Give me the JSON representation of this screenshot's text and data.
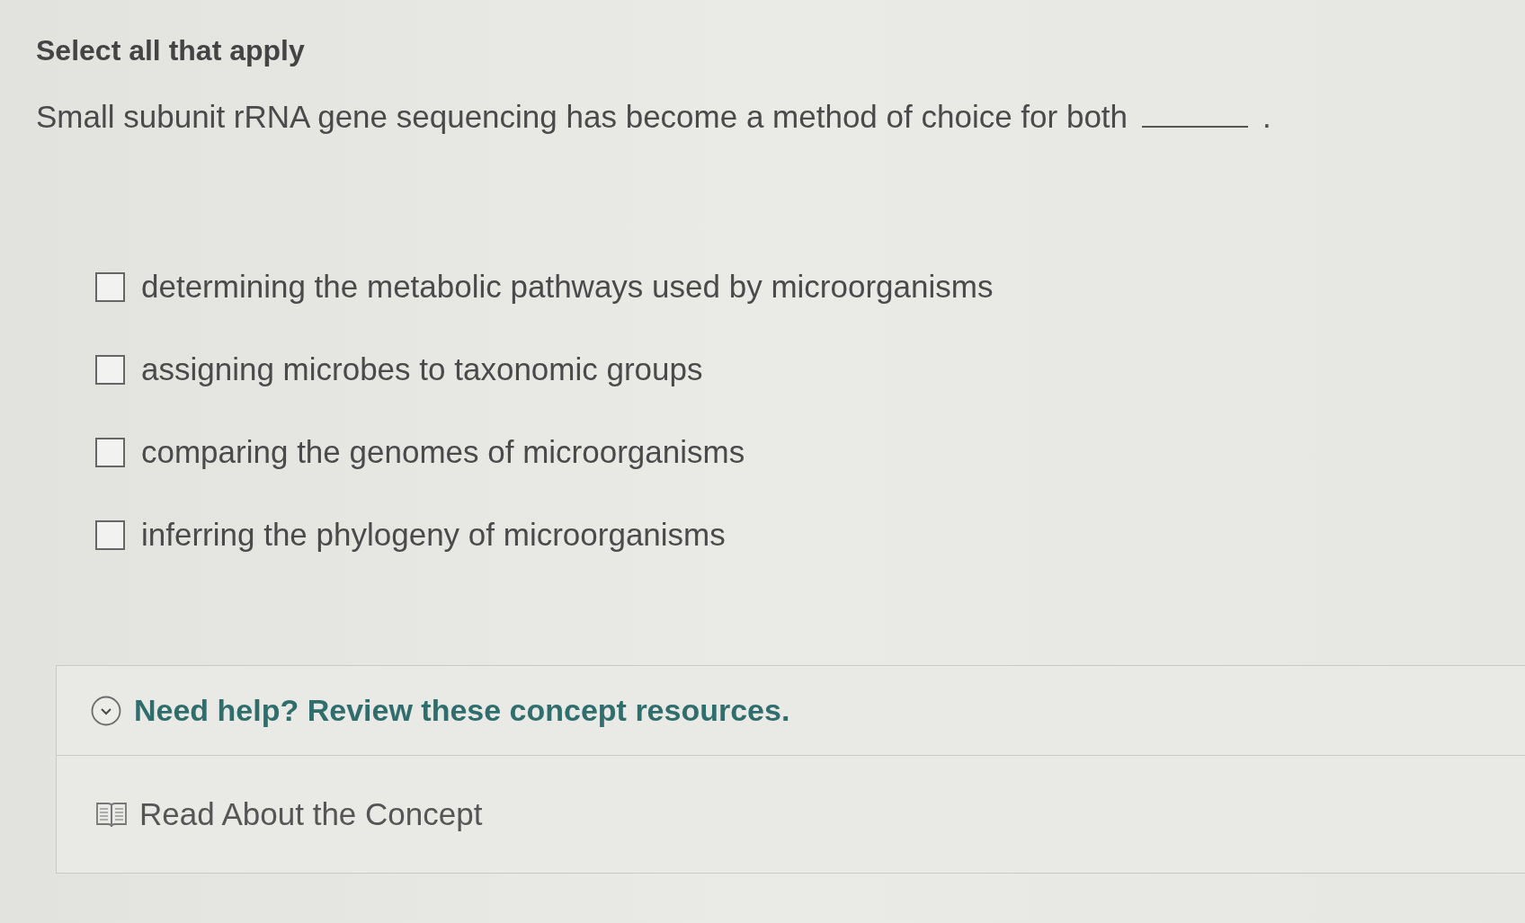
{
  "instruction": "Select all that apply",
  "question": {
    "segments": [
      {
        "kind": "text",
        "text": "Small subunit rRNA gene sequencing has become a method of choice for both"
      },
      {
        "kind": "blank"
      },
      {
        "kind": "text",
        "text": "."
      }
    ]
  },
  "options": [
    {
      "label": "determining the metabolic pathways used by microorganisms",
      "checked": false
    },
    {
      "label": "assigning microbes to taxonomic groups",
      "checked": false
    },
    {
      "label": "comparing the genomes of microorganisms",
      "checked": false
    },
    {
      "label": "inferring the phylogeny of microorganisms",
      "checked": false
    }
  ],
  "help": {
    "title": "Need help? Review these concept resources.",
    "resources": [
      {
        "label": "Read About the Concept"
      }
    ]
  }
}
